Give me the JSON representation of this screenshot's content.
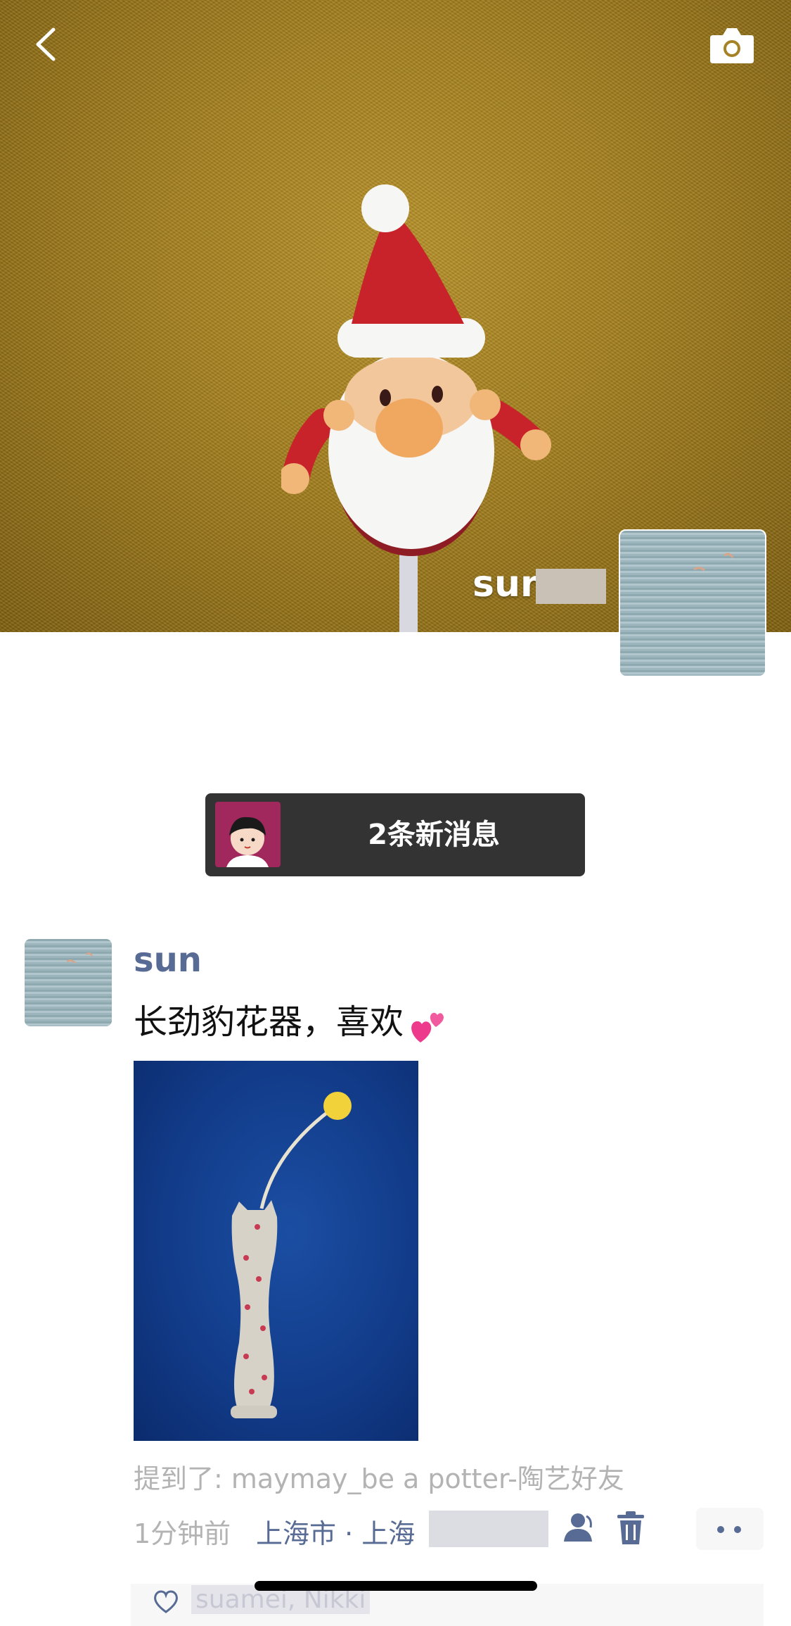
{
  "cover": {
    "user_name": "sun"
  },
  "new_messages": {
    "label": "2条新消息"
  },
  "post": {
    "author": "sun",
    "text": "长劲豹花器，喜欢",
    "mentioned": "提到了: maymay_be a potter-陶艺好友",
    "time": "1分钟前",
    "location": "上海市 · 上海",
    "likes": "suamei, Nikki"
  },
  "colors": {
    "link_blue": "#576b95",
    "meta_gray": "#b3b3b3",
    "pill_bg": "#333333"
  },
  "icons": [
    "back-icon",
    "camera-icon",
    "heart-emoji-icon",
    "who-can-see-icon",
    "delete-icon",
    "more-icon",
    "like-heart-icon"
  ]
}
